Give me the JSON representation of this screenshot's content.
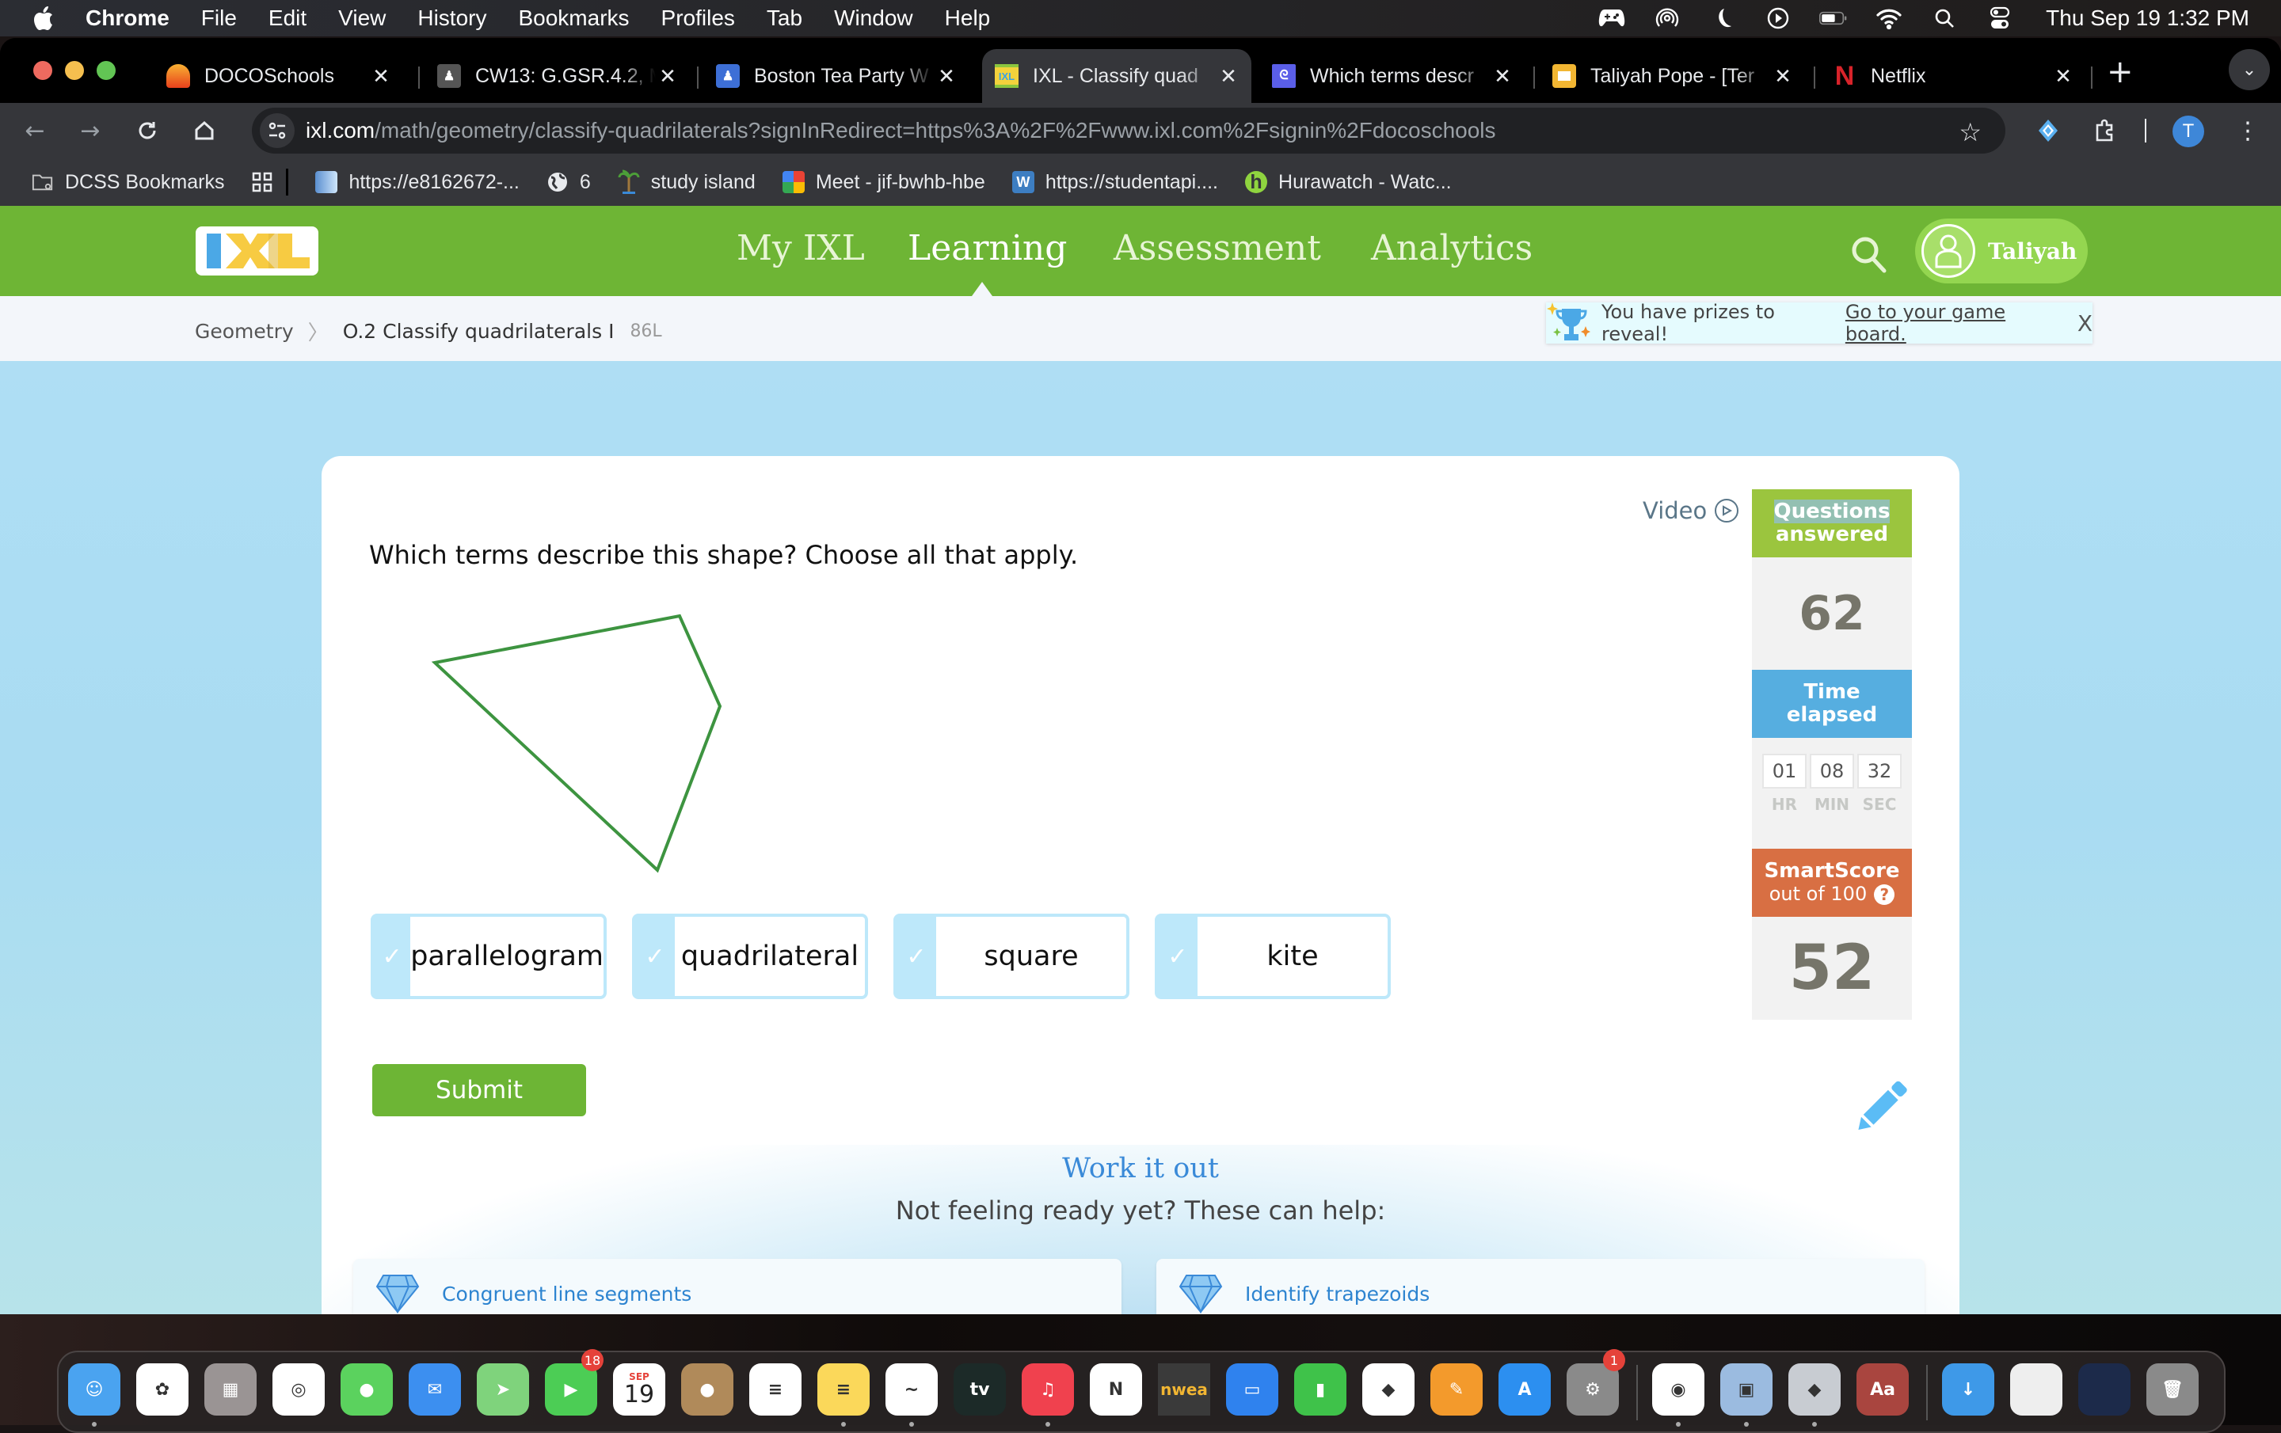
{
  "menubar": {
    "app": "Chrome",
    "items": [
      "File",
      "Edit",
      "View",
      "History",
      "Bookmarks",
      "Profiles",
      "Tab",
      "Window",
      "Help"
    ],
    "status_icons": [
      "gamepad-icon",
      "airdrop-icon",
      "moon-icon",
      "play-circle-icon",
      "battery-icon",
      "wifi-icon",
      "spotlight-search-icon",
      "control-center-icon"
    ],
    "clock": "Thu Sep 19  1:32 PM"
  },
  "tabs": [
    {
      "title": "DOCOSchools",
      "icon": "docoschools-icon",
      "color": "#e8622d",
      "active": false
    },
    {
      "title": "CW13: G.GSR.4.2, M",
      "icon": "classroom-icon",
      "color": "#555555",
      "active": false
    },
    {
      "title": "Boston Tea Party W",
      "icon": "classroom-icon",
      "color": "#3d6fd6",
      "active": false
    },
    {
      "title": "IXL - Classify quad",
      "icon": "ixl-icon",
      "color": "#8cc63e",
      "active": true
    },
    {
      "title": "Which terms descr",
      "icon": "app-icon",
      "color": "#5a5ee8",
      "active": false
    },
    {
      "title": "Taliyah Pope - [Ter",
      "icon": "slides-icon",
      "color": "#f2b632",
      "active": false
    },
    {
      "title": "Netflix",
      "icon": "netflix-icon",
      "color": "#d8232a",
      "active": false
    }
  ],
  "address": {
    "host": "ixl.com",
    "path": "/math/geometry/classify-quadrilaterals?signInRedirect=https%3A%2F%2Fwww.ixl.com%2Fsignin%2Fdocoschools"
  },
  "profile_initial": "T",
  "bookmarks": [
    {
      "label": "DCSS Bookmarks",
      "icon": "folder-icon"
    },
    {
      "label": "",
      "icon": "apps-grid-icon"
    },
    {
      "label": "https://e8162672-...",
      "icon": "book-icon"
    },
    {
      "label": "6",
      "icon": "globe-icon"
    },
    {
      "label": "study island",
      "icon": "palm-tree-icon"
    },
    {
      "label": "Meet - jif-bwhb-hbe",
      "icon": "meet-icon"
    },
    {
      "label": "https://studentapi....",
      "icon": "wordpress-icon"
    },
    {
      "label": "Hurawatch - Watc...",
      "icon": "hurawatch-icon"
    }
  ],
  "ixl": {
    "nav": [
      "My IXL",
      "Learning",
      "Assessment",
      "Analytics"
    ],
    "active_nav": "Learning",
    "user": "Taliyah",
    "breadcrumb": {
      "subject": "Geometry",
      "skill": "O.2 Classify quadrilaterals I",
      "code": "86L"
    },
    "prizes": {
      "text": "You have prizes to reveal!",
      "link": "Go to your game board.",
      "close": "X"
    },
    "question": "Which terms describe this shape? Choose all that apply.",
    "choices": [
      {
        "label": "parallelogram",
        "selected": false
      },
      {
        "label": "quadrilateral",
        "selected": false
      },
      {
        "label": "square",
        "selected": false
      },
      {
        "label": "kite",
        "selected": false
      }
    ],
    "submit": "Submit",
    "video": "Video",
    "stats": {
      "questions_label_1": "Questions",
      "questions_label_2": "answered",
      "questions_value": "62",
      "time_label_1": "Time",
      "time_label_2": "elapsed",
      "hr": "01",
      "min": "08",
      "sec": "32",
      "hr_label": "HR",
      "min_label": "MIN",
      "sec_label": "SEC",
      "score_label_1": "SmartScore",
      "score_label_2": "out of 100",
      "score_help": "?",
      "score_value": "52"
    },
    "work_it_out": {
      "title": "Work it out",
      "subtitle": "Not feeling ready yet? These can help:",
      "links": [
        "Congruent line segments",
        "Identify trapezoids"
      ]
    },
    "colors": {
      "brand_green": "#6eb535",
      "shape_stroke": "#3d9440",
      "questions": "#9bc53e",
      "time": "#56aee0",
      "smartscore": "#d86f43",
      "link_blue": "#2d84d0"
    }
  },
  "dock": {
    "apps": [
      {
        "name": "Finder",
        "color": "#4aa3f0",
        "glyph": "☺"
      },
      {
        "name": "Photos",
        "color": "#ffffff",
        "glyph": "✿"
      },
      {
        "name": "Launchpad",
        "color": "#9a9494",
        "glyph": "▦"
      },
      {
        "name": "Safari",
        "color": "#ffffff",
        "glyph": "◎"
      },
      {
        "name": "Messages",
        "color": "#5bd25e",
        "glyph": "●"
      },
      {
        "name": "Mail",
        "color": "#3c8ff0",
        "glyph": "✉"
      },
      {
        "name": "Maps",
        "color": "#7fd37c",
        "glyph": "➤"
      },
      {
        "name": "FaceTime",
        "color": "#4ccd55",
        "glyph": "▶",
        "badge": "18"
      },
      {
        "name": "Calendar",
        "color": "#ffffff",
        "glyph": "19",
        "sub": "SEP"
      },
      {
        "name": "Contacts",
        "color": "#b08a5a",
        "glyph": "●"
      },
      {
        "name": "Reminders",
        "color": "#ffffff",
        "glyph": "≡"
      },
      {
        "name": "Notes",
        "color": "#fbd85a",
        "glyph": "≡"
      },
      {
        "name": "Freeform",
        "color": "#ffffff",
        "glyph": "~"
      },
      {
        "name": "TV",
        "color": "#1c2a28",
        "glyph": "tv"
      },
      {
        "name": "Music",
        "color": "#f0414e",
        "glyph": "♫"
      },
      {
        "name": "News",
        "color": "#ffffff",
        "glyph": "N"
      },
      {
        "name": "NWEA",
        "color": "#3a3a3a",
        "glyph": "nwea"
      },
      {
        "name": "Keynote",
        "color": "#2f82ee",
        "glyph": "▭"
      },
      {
        "name": "Numbers",
        "color": "#3fc24a",
        "glyph": "▮"
      },
      {
        "name": "Gameboard",
        "color": "#ffffff",
        "glyph": "◆"
      },
      {
        "name": "Pages",
        "color": "#f39a2c",
        "glyph": "✎"
      },
      {
        "name": "App Store",
        "color": "#2c8ff0",
        "glyph": "A"
      },
      {
        "name": "System Settings",
        "color": "#8a8a8a",
        "glyph": "⚙",
        "badge": "1"
      },
      {
        "name": "Chrome",
        "color": "#ffffff",
        "glyph": "◉"
      },
      {
        "name": "Preview",
        "color": "#9bbbe0",
        "glyph": "▣"
      },
      {
        "name": "Roblox",
        "color": "#c8ccd2",
        "glyph": "◆"
      },
      {
        "name": "Dictionary",
        "color": "#a9453f",
        "glyph": "Aa"
      },
      {
        "name": "Downloads",
        "color": "#3e99e8",
        "glyph": "↓"
      },
      {
        "name": "Screenshot 1",
        "color": "#eeeeee",
        "glyph": ""
      },
      {
        "name": "Screenshot 2",
        "color": "#1c2a4a",
        "glyph": ""
      },
      {
        "name": "Trash",
        "color": "#8a8a8a",
        "glyph": "🗑"
      }
    ]
  }
}
